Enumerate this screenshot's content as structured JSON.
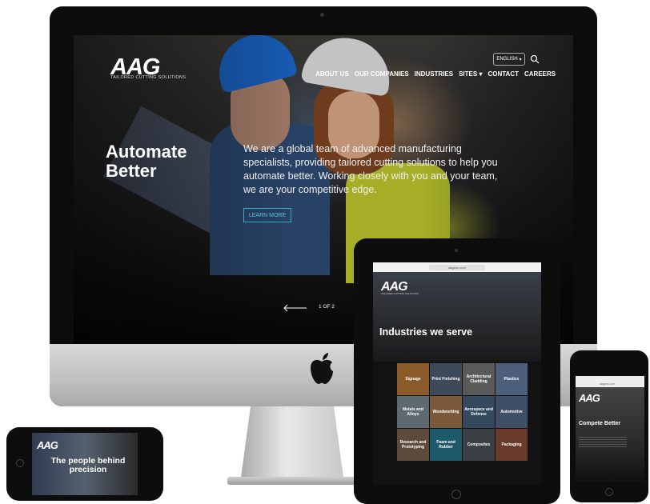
{
  "desktop": {
    "logo": "AAG",
    "tagline": "TAILORED CUTTING SOLUTIONS",
    "language": "ENGLISH",
    "nav": [
      "ABOUT US",
      "OUR COMPANIES",
      "INDUSTRIES",
      "SITES",
      "CONTACT",
      "CAREERS"
    ],
    "hero_title": "Automate Better",
    "hero_body": "We are a global team of advanced manufacturing specialists, providing tailored cutting solutions to help you automate better. Working closely with you and your team, we are your competitive edge.",
    "cta": "LEARN MORE",
    "pager": "1 OF 2"
  },
  "tablet": {
    "url": "aagcnc.com",
    "logo": "AAG",
    "tagline": "TAILORED CUTTING SOLUTIONS",
    "heading": "Industries we serve",
    "industries": [
      "Signage",
      "Print Finishing",
      "Architectural Cladding",
      "Plastics",
      "Metals and Alloys",
      "Woodworking",
      "Aerospace and Defense",
      "Automotive",
      "Research and Prototyping",
      "Foam and Rubber",
      "Composites",
      "Packaging"
    ]
  },
  "phone_right": {
    "url": "aagcnc.com",
    "logo": "AAG",
    "title": "Compete Better"
  },
  "phone_left": {
    "logo": "AAG",
    "title": "The people behind precision"
  },
  "colors": {
    "accent": "#3aa7c9",
    "vest": "#b9c22c",
    "hardhat": "#1a66c8"
  }
}
